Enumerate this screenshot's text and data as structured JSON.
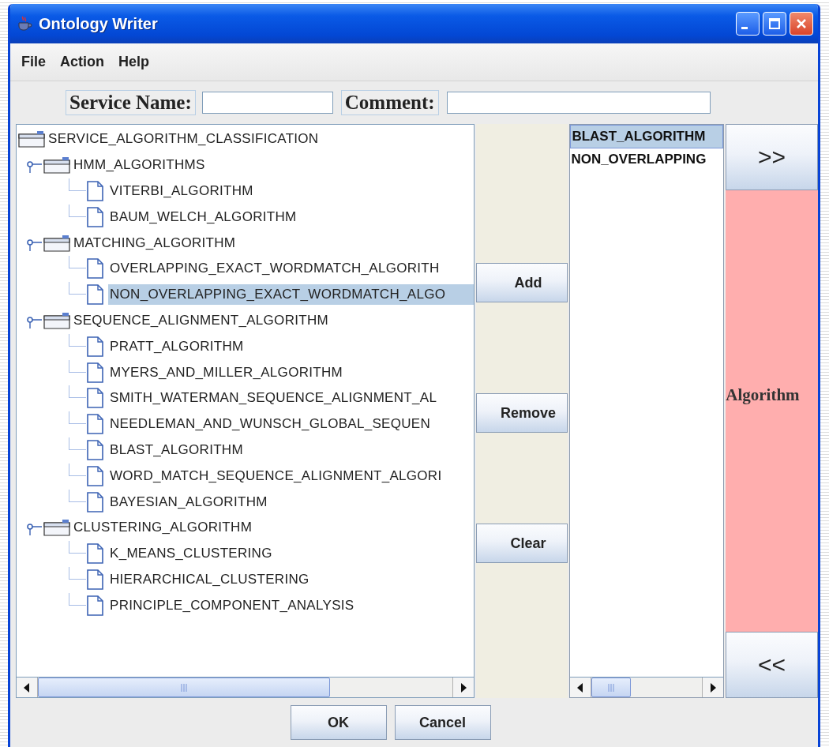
{
  "window": {
    "title": "Ontology Writer"
  },
  "menu": [
    {
      "label": "File"
    },
    {
      "label": "Action"
    },
    {
      "label": "Help"
    }
  ],
  "fields": [
    {
      "label": "Service Name:",
      "kind": "short"
    },
    {
      "label": "Comment:",
      "kind": "long"
    }
  ],
  "tree": {
    "label": "SERVICE_ALGORITHM_CLASSIFICATION",
    "selected": false,
    "children": [
      {
        "label": "HMM_ALGORITHMS",
        "expanded": true,
        "selected": false,
        "children": [
          {
            "label": "VITERBI_ALGORITHM",
            "selected": false
          },
          {
            "label": "BAUM_WELCH_ALGORITHM",
            "selected": false
          }
        ]
      },
      {
        "label": "MATCHING_ALGORITHM",
        "expanded": true,
        "selected": false,
        "children": [
          {
            "label": "OVERLAPPING_EXACT_WORDMATCH_ALGORITH",
            "selected": false
          },
          {
            "label": "NON_OVERLAPPING_EXACT_WORDMATCH_ALGO",
            "selected": true
          }
        ]
      },
      {
        "label": "SEQUENCE_ALIGNMENT_ALGORITHM",
        "expanded": true,
        "selected": false,
        "children": [
          {
            "label": "PRATT_ALGORITHM",
            "selected": false
          },
          {
            "label": "MYERS_AND_MILLER_ALGORITHM",
            "selected": false
          },
          {
            "label": "SMITH_WATERMAN_SEQUENCE_ALIGNMENT_AL",
            "selected": false
          },
          {
            "label": "NEEDLEMAN_AND_WUNSCH_GLOBAL_SEQUEN",
            "selected": false
          },
          {
            "label": "BLAST_ALGORITHM",
            "selected": false
          },
          {
            "label": "WORD_MATCH_SEQUENCE_ALIGNMENT_ALGORI",
            "selected": false
          },
          {
            "label": "BAYESIAN_ALGORITHM",
            "selected": false
          }
        ]
      },
      {
        "label": "CLUSTERING_ALGORITHM",
        "expanded": true,
        "selected": false,
        "children": [
          {
            "label": "K_MEANS_CLUSTERING",
            "selected": false
          },
          {
            "label": "HIERARCHICAL_CLUSTERING",
            "selected": false
          },
          {
            "label": "PRINCIPLE_COMPONENT_ANALYSIS",
            "selected": false
          }
        ]
      }
    ]
  },
  "actions": [
    {
      "label": "Add"
    },
    {
      "label": "Remove"
    },
    {
      "label": "Clear"
    }
  ],
  "selected_list": [
    {
      "label": "BLAST_ALGORITHM",
      "selected": true
    },
    {
      "label": "NON_OVERLAPPING",
      "selected": false
    }
  ],
  "category": {
    "next": ">>",
    "label": "Algorithm",
    "previous": "<<"
  },
  "buttons": [
    {
      "label": "OK"
    },
    {
      "label": "Cancel"
    }
  ]
}
